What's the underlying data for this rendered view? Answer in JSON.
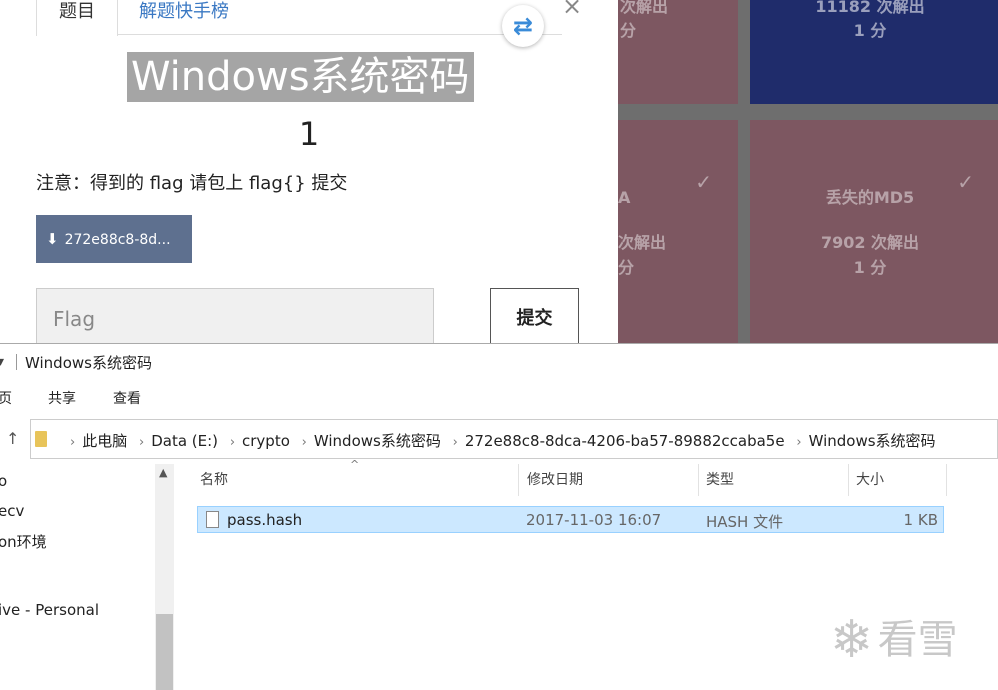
{
  "background_tiles": {
    "tile1": {
      "line1": "次解出",
      "line2": "分"
    },
    "tile2": {
      "line1": "11182 次解出",
      "line2": "1 分"
    },
    "tile3": {
      "line1": "A",
      "line2": "次解出",
      "line3": "分"
    },
    "tile4": {
      "name": "丢失的MD5",
      "solves": "7902 次解出",
      "points": "1 分"
    },
    "check_icon": "✓"
  },
  "modal": {
    "tabs": [
      "题目",
      "解题快手榜"
    ],
    "close_icon": "×",
    "swap_icon": "⇄",
    "title": "Windows系统密码",
    "points": "1",
    "note": "注意：得到的 flag 请包上 flag{} 提交",
    "download_label": "272e88c8-8d...",
    "download_icon": "⬇",
    "flag_placeholder": "Flag",
    "submit_label": "提交"
  },
  "explorer": {
    "window_title": "Windows系统密码",
    "ribbon_tabs": [
      "页",
      "共享",
      "查看"
    ],
    "breadcrumb": [
      "此电脑",
      "Data (E:)",
      "crypto",
      "Windows系统密码",
      "272e88c8-8dca-4206-ba57-89882ccaba5e",
      "Windows系统密码"
    ],
    "nav_items": [
      "o",
      "ecv",
      "on环境",
      "ive - Personal"
    ],
    "columns": [
      "名称",
      "修改日期",
      "类型",
      "大小"
    ],
    "files": [
      {
        "name": "pass.hash",
        "modified": "2017-11-03 16:07",
        "type": "HASH 文件",
        "size": "1 KB"
      }
    ]
  },
  "watermark": {
    "text": "看雪",
    "icon": "❄"
  }
}
